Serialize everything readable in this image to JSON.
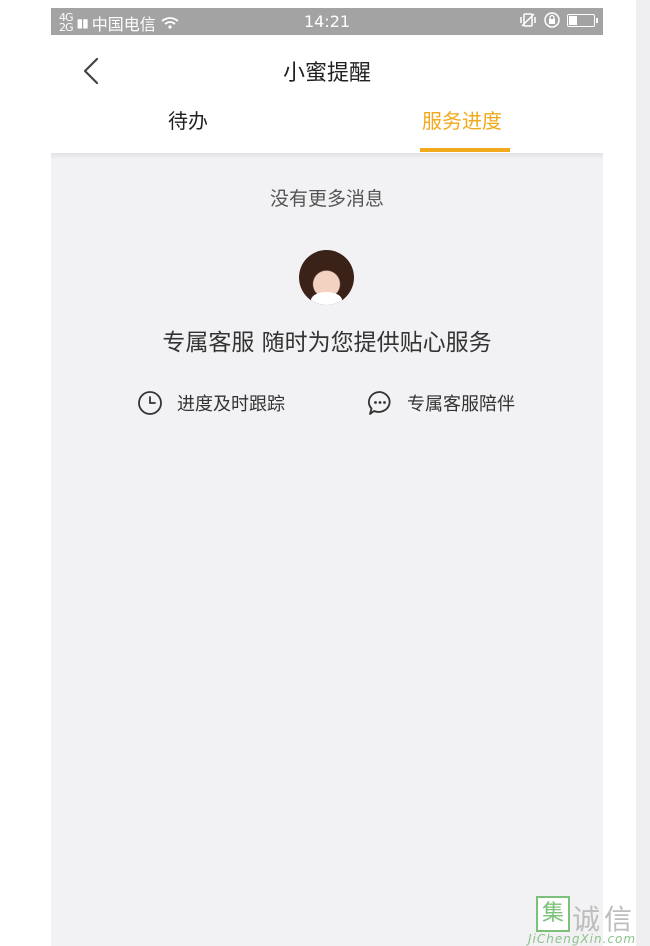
{
  "status_bar": {
    "signal_text": "4G​2G",
    "carrier": "中国电信",
    "time": "14:21",
    "battery_level": 0.35
  },
  "header": {
    "title": "小蜜提醒",
    "tabs": [
      {
        "label": "待办",
        "active": false
      },
      {
        "label": "服务进度",
        "active": true
      }
    ]
  },
  "content": {
    "no_more_text": "没有更多消息",
    "slogan": "专属客服 随时为您提供贴心服务",
    "features": [
      {
        "icon": "clock-icon",
        "label": "进度及时跟踪"
      },
      {
        "icon": "chat-bubble-icon",
        "label": "专属客服陪伴"
      }
    ]
  },
  "watermark": {
    "logo_char": "集",
    "text": "诚信",
    "url": "JiChengXin.com"
  },
  "colors": {
    "accent": "#f2a91c",
    "background": "#f2f2f4",
    "statusbar": "#a3a3a3"
  }
}
